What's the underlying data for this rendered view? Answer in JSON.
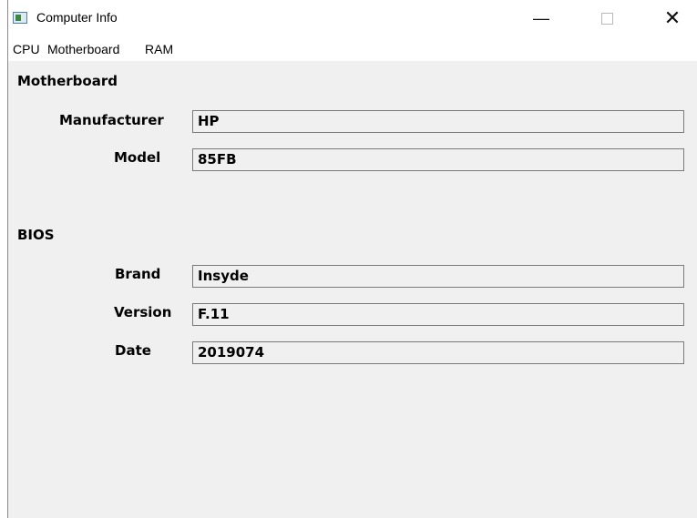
{
  "window": {
    "title": "Computer Info",
    "minimize_label": "—",
    "close_label": "✕"
  },
  "menu": {
    "items": [
      {
        "label": "CPU"
      },
      {
        "label": "Motherboard"
      },
      {
        "label": "RAM"
      }
    ]
  },
  "motherboard": {
    "section_title": "Motherboard",
    "manufacturer_label": "Manufacturer",
    "manufacturer_value": "HP",
    "model_label": "Model",
    "model_value": "85FB"
  },
  "bios": {
    "section_title": "BIOS",
    "brand_label": "Brand",
    "brand_value": "Insyde",
    "version_label": "Version",
    "version_value": "F.11",
    "date_label": "Date",
    "date_value": "2019074"
  },
  "icons": {
    "app": "app-window-icon",
    "minimize": "minimize-icon",
    "maximize": "maximize-icon",
    "close": "close-icon"
  }
}
